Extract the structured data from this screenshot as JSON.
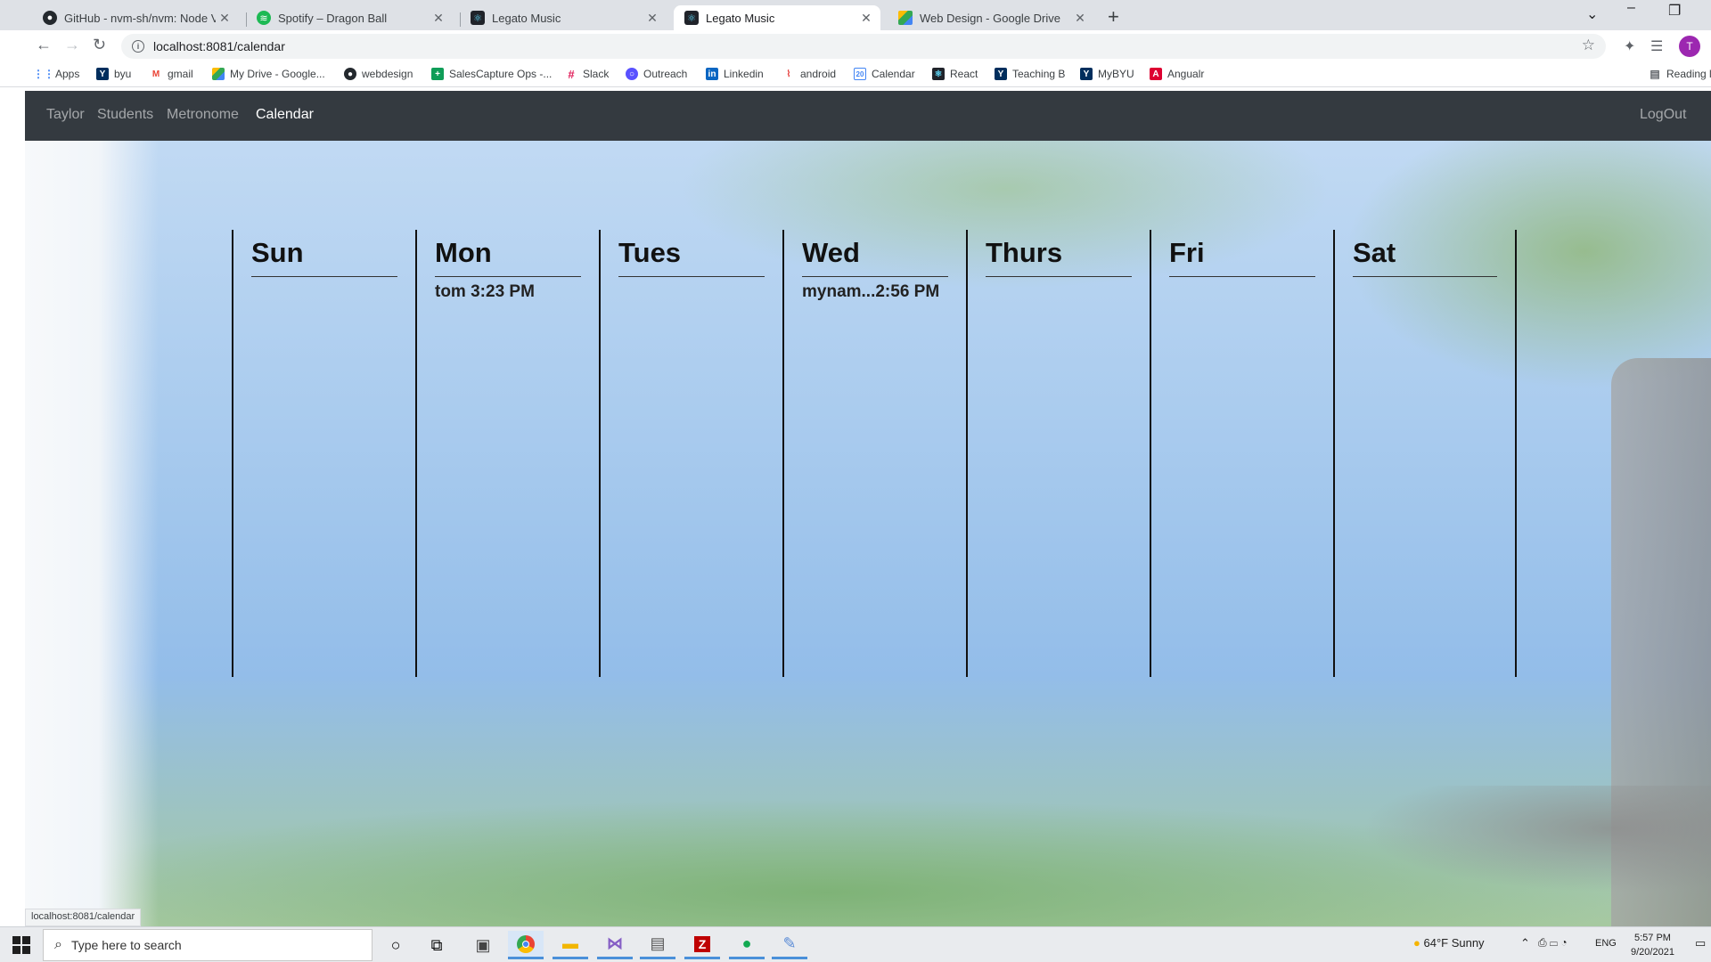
{
  "browser": {
    "tabs": [
      {
        "title": "GitHub - nvm-sh/nvm: Node Ver",
        "icon": "github-icon",
        "active": false
      },
      {
        "title": "Spotify – Dragon Ball",
        "icon": "spotify-icon",
        "active": false
      },
      {
        "title": "Legato Music",
        "icon": "react-icon",
        "active": false
      },
      {
        "title": "Legato Music",
        "icon": "react-icon",
        "active": true
      },
      {
        "title": "Web Design - Google Drive",
        "icon": "google-drive-icon",
        "active": false
      }
    ],
    "url": "localhost:8081/calendar",
    "profile_initial": "T",
    "bookmarks": [
      {
        "label": "Apps",
        "icon": "apps-grid-icon"
      },
      {
        "label": "byu",
        "icon": "byu-icon"
      },
      {
        "label": "gmail",
        "icon": "gmail-icon"
      },
      {
        "label": "My Drive - Google...",
        "icon": "google-drive-icon"
      },
      {
        "label": "webdesign",
        "icon": "github-icon"
      },
      {
        "label": "SalesCapture Ops -...",
        "icon": "salescapture-icon"
      },
      {
        "label": "Slack",
        "icon": "slack-icon"
      },
      {
        "label": "Outreach",
        "icon": "outreach-icon"
      },
      {
        "label": "Linkedin",
        "icon": "linkedin-icon"
      },
      {
        "label": "android",
        "icon": "android-icon"
      },
      {
        "label": "Calendar",
        "icon": "calendar-icon"
      },
      {
        "label": "React",
        "icon": "react-icon"
      },
      {
        "label": "Teaching B",
        "icon": "byu-icon"
      },
      {
        "label": "MyBYU",
        "icon": "byu-icon"
      },
      {
        "label": "Angualr",
        "icon": "angular-icon"
      }
    ],
    "reading_list": "Reading l",
    "status_url": "localhost:8081/calendar"
  },
  "app": {
    "nav": {
      "brand": "Taylor",
      "links": [
        "Students",
        "Metronome",
        "Calendar"
      ],
      "active": "Calendar",
      "logout": "LogOut"
    },
    "calendar": {
      "days": [
        {
          "name": "Sun",
          "events": []
        },
        {
          "name": "Mon",
          "events": [
            "tom 3:23 PM"
          ]
        },
        {
          "name": "Tues",
          "events": []
        },
        {
          "name": "Wed",
          "events": [
            "mynam...2:56 PM"
          ]
        },
        {
          "name": "Thurs",
          "events": []
        },
        {
          "name": "Fri",
          "events": []
        },
        {
          "name": "Sat",
          "events": []
        }
      ]
    }
  },
  "taskbar": {
    "search_placeholder": "Type here to search",
    "weather": "64°F  Sunny",
    "language": "ENG",
    "time": "5:57 PM",
    "date": "9/20/2021"
  }
}
